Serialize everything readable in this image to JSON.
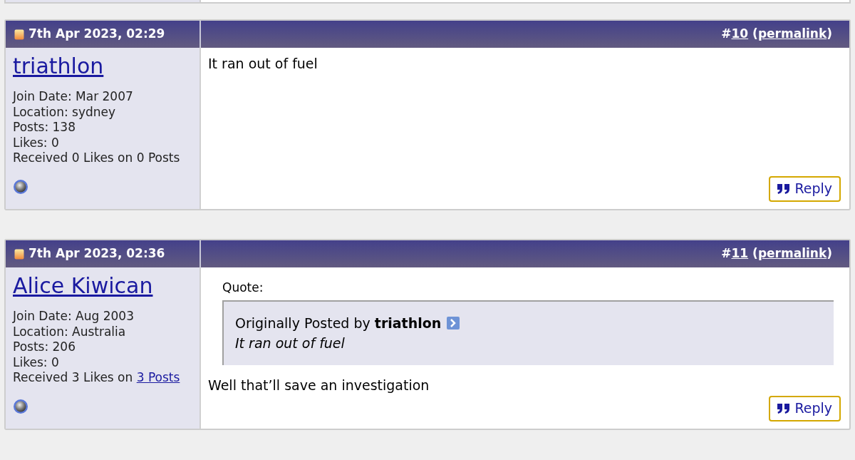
{
  "posts": [
    {
      "date": "7th Apr 2023, 02:29",
      "header_right": [
        {
          "kind": "text",
          "text": "#"
        },
        {
          "kind": "link",
          "text": "10"
        },
        {
          "kind": "text",
          "text": " ("
        },
        {
          "kind": "link",
          "text": "permalink"
        },
        {
          "kind": "text",
          "text": ")"
        }
      ],
      "user": {
        "name": "triathlon",
        "stats": [
          {
            "text": "Join Date: Mar 2007"
          },
          {
            "text": "Location: sydney"
          },
          {
            "text": "Posts: 138"
          },
          {
            "text": "Likes: 0"
          },
          {
            "text": "Received 0 Likes on 0 Posts"
          }
        ]
      },
      "body": [
        {
          "kind": "text",
          "text": "It ran out of fuel"
        }
      ],
      "reply": "Reply"
    },
    {
      "date": "7th Apr 2023, 02:36",
      "header_right": [
        {
          "kind": "text",
          "text": "#"
        },
        {
          "kind": "link",
          "text": "11"
        },
        {
          "kind": "text",
          "text": " ("
        },
        {
          "kind": "link",
          "text": "permalink"
        },
        {
          "kind": "text",
          "text": ")"
        }
      ],
      "user": {
        "name": "Alice Kiwican",
        "stats": [
          {
            "text": "Join Date: Aug 2003"
          },
          {
            "text": "Location: Australia"
          },
          {
            "text": "Posts: 206"
          },
          {
            "text": "Likes: 0"
          },
          {
            "text": "Received 3 Likes on ",
            "link": "3 Posts"
          }
        ]
      },
      "body": [
        {
          "kind": "quote",
          "label": "Quote:",
          "prefix": "Originally Posted by",
          "author": "triathlon",
          "text": "It ran out of fuel"
        },
        {
          "kind": "text",
          "text": "Well that’ll save an investigation"
        }
      ],
      "reply": "Reply"
    }
  ]
}
